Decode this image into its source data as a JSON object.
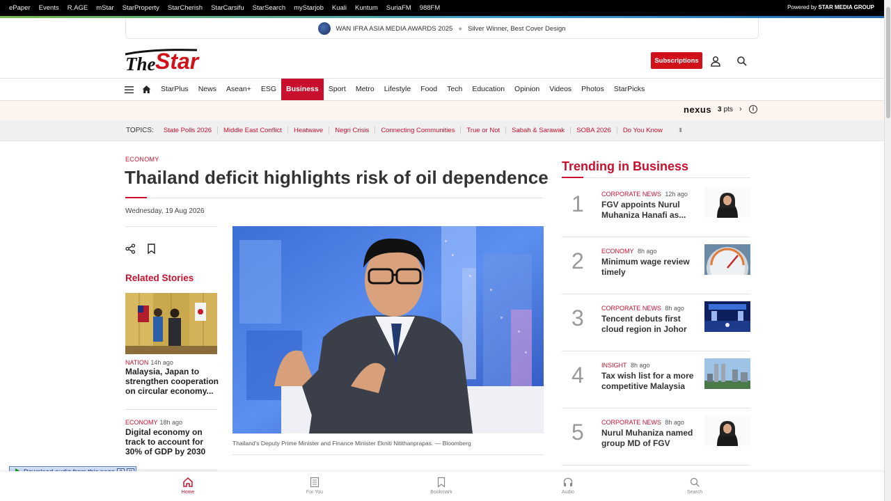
{
  "topbar": {
    "links": [
      "ePaper",
      "Events",
      "R.AGE",
      "mStar",
      "StarProperty",
      "StarCherish",
      "StarCarsifu",
      "StarSearch",
      "myStarjob",
      "Kuali",
      "Kuntum",
      "SuriaFM",
      "988FM"
    ],
    "powered_prefix": "Powered by",
    "powered_brand": "STAR MEDIA GROUP"
  },
  "award": {
    "title": "WAN IFRA ASIA MEDIA AWARDS 2025",
    "subtitle": "Silver Winner, Best Cover Design"
  },
  "header": {
    "logo_text_the": "The",
    "logo_text_star": "Star",
    "subscribe_label": "Subscriptions"
  },
  "nav": {
    "items": [
      "StarPlus",
      "News",
      "Asean+",
      "ESG",
      "Business",
      "Sport",
      "Metro",
      "Lifestyle",
      "Food",
      "Tech",
      "Education",
      "Opinion",
      "Videos",
      "Photos",
      "StarPicks"
    ],
    "active": "Business"
  },
  "nexus": {
    "brand": "nexus",
    "points": "3",
    "points_unit": "pts"
  },
  "topics": {
    "label": "TOPICS:",
    "items": [
      "State Polls 2026",
      "Middle East Conflict",
      "Heatwave",
      "Negri Crisis",
      "Connecting Communities",
      "True or Not",
      "Sabah & Sarawak",
      "SOBA 2026",
      "Do You Know"
    ]
  },
  "article": {
    "category": "ECONOMY",
    "headline": "Thailand deficit highlights risk of oil dependence",
    "date": "Wednesday, 19 Aug 2026",
    "caption": "Thailand's Deputy Prime Minister and Finance Minister Ekniti Nitithanprapas. — Bloomberg"
  },
  "related": {
    "title": "Related Stories",
    "stories": [
      {
        "category": "NATION",
        "ago": "14h ago",
        "title": "Malaysia, Japan to strengthen cooperation on circular economy..."
      },
      {
        "category": "ECONOMY",
        "ago": "18h ago",
        "title": "Digital economy on track to account for 30% of GDP by 2030"
      }
    ]
  },
  "trending": {
    "title": "Trending in Business",
    "items": [
      {
        "num": "1",
        "category": "CORPORATE NEWS",
        "ago": "12h ago",
        "title": "FGV appoints Nurul Muhaniza Hanafi as..."
      },
      {
        "num": "2",
        "category": "ECONOMY",
        "ago": "8h ago",
        "title": "Minimum wage review timely"
      },
      {
        "num": "3",
        "category": "CORPORATE NEWS",
        "ago": "8h ago",
        "title": "Tencent debuts first cloud region in Johor"
      },
      {
        "num": "4",
        "category": "INSIGHT",
        "ago": "8h ago",
        "title": "Tax wish list for a more competitive Malaysia"
      },
      {
        "num": "5",
        "category": "CORPORATE NEWS",
        "ago": "8h ago",
        "title": "Nurul Muhaniza named group MD of FGV"
      }
    ]
  },
  "audio": {
    "label": "Download audio from this page",
    "help": "?",
    "close": "X"
  },
  "bottomnav": {
    "items": [
      "Home",
      "For You",
      "Bookmark",
      "Audio",
      "Search"
    ]
  },
  "colors": {
    "brand_red": "#c8102e",
    "subscribe_red": "#d0111a"
  }
}
